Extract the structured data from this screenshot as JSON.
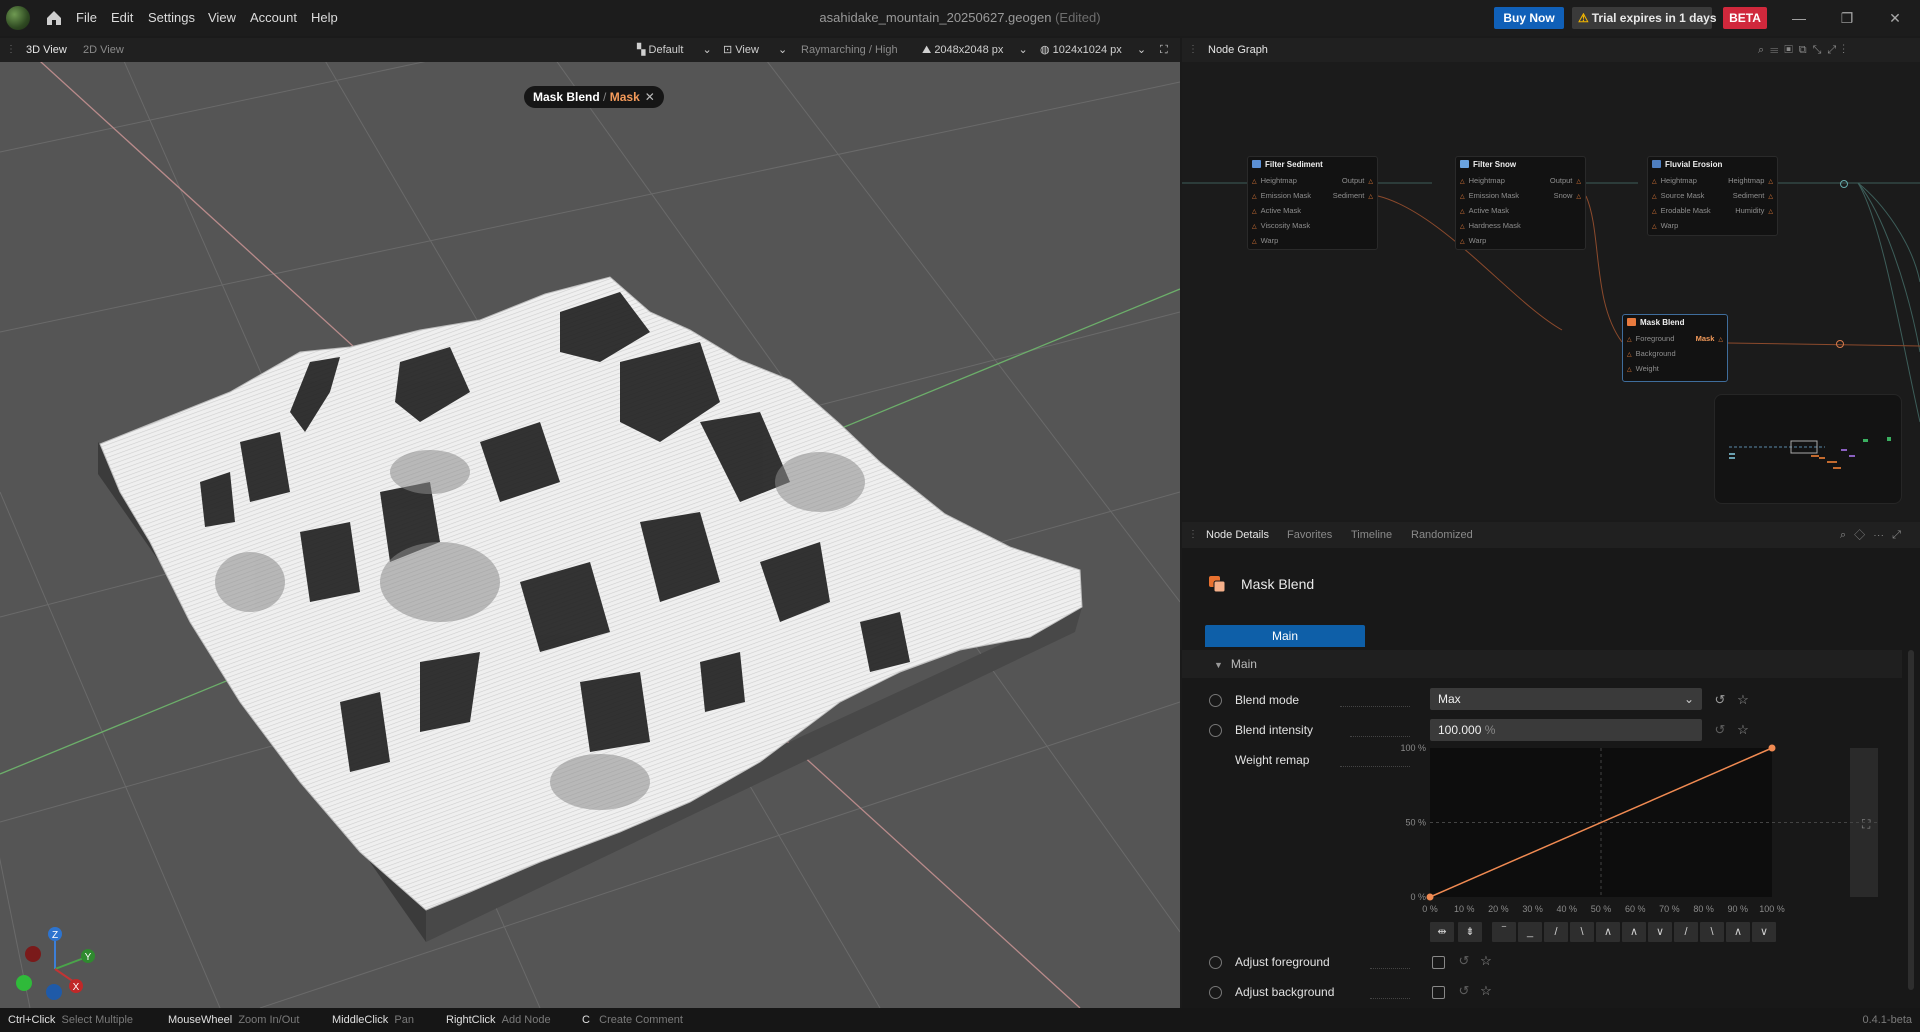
{
  "app": {
    "window_title": "asahidake_mountain_20250627.geogen",
    "edited_label": "(Edited)",
    "menu": [
      "File",
      "Edit",
      "Settings",
      "View",
      "Account",
      "Help"
    ],
    "buy_now": "Buy Now",
    "trial": "Trial expires in 1 days",
    "beta": "BETA",
    "window_controls": {
      "minimize": "—",
      "restore": "❐",
      "close": "✕"
    }
  },
  "viewport_toolbar": {
    "tabs": [
      "3D View",
      "2D View"
    ],
    "preset": "Default",
    "view": "View",
    "render_mode": "Raymarching / High",
    "resolution": "2048x2048 px",
    "display_resolution": "1024x1024 px"
  },
  "viewport": {
    "badge_node": "Mask Blend",
    "badge_sep": "/",
    "badge_port": "Mask",
    "badge_close": "✕",
    "gizmo": {
      "z": "Z",
      "y": "Y",
      "x": "X"
    }
  },
  "node_graph": {
    "title": "Node Graph",
    "nodes": [
      {
        "title": "Filter Sediment",
        "inputs": [
          "Heightmap",
          "Emission Mask",
          "Active Mask",
          "Viscosity Mask",
          "Warp"
        ],
        "outputs": [
          "Output",
          "Sediment"
        ],
        "icon_color": "#5b8fd4"
      },
      {
        "title": "Filter Snow",
        "inputs": [
          "Heightmap",
          "Emission Mask",
          "Active Mask",
          "Hardness Mask",
          "Warp"
        ],
        "outputs": [
          "Output",
          "Snow"
        ],
        "icon_color": "#6aa3e0"
      },
      {
        "title": "Fluvial Erosion",
        "inputs": [
          "Heightmap",
          "Source Mask",
          "Erodable Mask",
          "Warp"
        ],
        "outputs": [
          "Heightmap",
          "Sediment",
          "Humidity"
        ],
        "icon_color": "#4f7fc0"
      },
      {
        "title": "Mask Blend",
        "inputs": [
          "Foreground",
          "Background",
          "Weight"
        ],
        "outputs": [
          "Mask"
        ],
        "icon_color": "#e87a3e"
      }
    ]
  },
  "node_details": {
    "tabs": [
      "Node Details",
      "Favorites",
      "Timeline",
      "Randomized"
    ],
    "node_title": "Mask Blend",
    "main_tab": "Main",
    "section": "Main",
    "blend_mode_label": "Blend mode",
    "blend_mode_value": "Max",
    "blend_intensity_label": "Blend intensity",
    "blend_intensity_value": "100.000",
    "blend_intensity_unit": "%",
    "weight_remap_label": "Weight remap",
    "curve_y_labels": [
      "100 %",
      "50 %",
      "0 %"
    ],
    "curve_x_labels": [
      "0 %",
      "10 %",
      "20 %",
      "30 %",
      "40 %",
      "50 %",
      "60 %",
      "70 %",
      "80 %",
      "90 %",
      "100 %"
    ],
    "curve_points": [
      [
        0,
        0
      ],
      [
        1,
        1
      ]
    ],
    "curve_presets": [
      "⇹",
      "⇟",
      "‾",
      "_",
      "/",
      "\\",
      "∧",
      "∧",
      "∨",
      "/",
      "\\",
      "∧",
      "∨"
    ],
    "adjust_foreground_label": "Adjust foreground",
    "adjust_background_label": "Adjust background",
    "adjust_foreground": false,
    "adjust_background": false
  },
  "status_bar": {
    "hints": [
      {
        "key": "Ctrl+Click",
        "desc": "Select Multiple"
      },
      {
        "key": "MouseWheel",
        "desc": "Zoom In/Out"
      },
      {
        "key": "MiddleClick",
        "desc": "Pan"
      },
      {
        "key": "RightClick",
        "desc": "Add Node"
      },
      {
        "key": "C",
        "desc": "Create Comment"
      }
    ],
    "version": "0.4.1-beta"
  },
  "colors": {
    "accent": "#0e5fa8",
    "orange": "#f0925a",
    "beta": "#d0283c"
  }
}
